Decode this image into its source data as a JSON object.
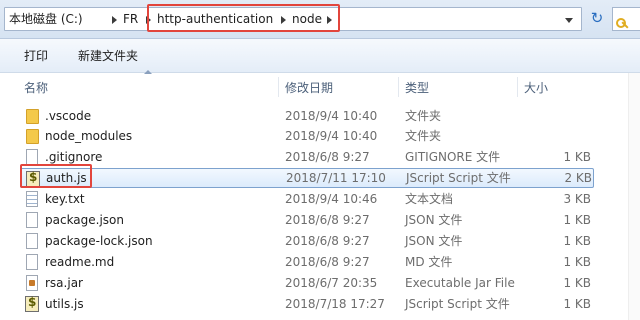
{
  "address": {
    "crumbs": [
      {
        "label": "本地磁盘 (C:)"
      },
      {
        "label": "FR"
      },
      {
        "label": "http-authentication"
      },
      {
        "label": "node"
      }
    ]
  },
  "toolbar": {
    "print_label": "打印",
    "new_folder_label": "新建文件夹"
  },
  "columns": {
    "name": "名称",
    "date": "修改日期",
    "type": "类型",
    "size": "大小"
  },
  "files": [
    {
      "name": ".vscode",
      "date": "2018/9/4 10:40",
      "type": "文件夹",
      "size": "",
      "icon": "folder-icon"
    },
    {
      "name": "node_modules",
      "date": "2018/9/4 10:40",
      "type": "文件夹",
      "size": "",
      "icon": "folder-icon"
    },
    {
      "name": ".gitignore",
      "date": "2018/6/8 9:27",
      "type": "GITIGNORE 文件",
      "size": "1 KB",
      "icon": "file-icon"
    },
    {
      "name": "auth.js",
      "date": "2018/7/11 17:10",
      "type": "JScript Script 文件",
      "size": "2 KB",
      "icon": "jscript-icon",
      "selected": true
    },
    {
      "name": "key.txt",
      "date": "2018/9/4 10:46",
      "type": "文本文档",
      "size": "3 KB",
      "icon": "text-file-icon"
    },
    {
      "name": "package.json",
      "date": "2018/6/8 9:27",
      "type": "JSON 文件",
      "size": "1 KB",
      "icon": "file-icon"
    },
    {
      "name": "package-lock.json",
      "date": "2018/6/8 9:27",
      "type": "JSON 文件",
      "size": "1 KB",
      "icon": "file-icon"
    },
    {
      "name": "readme.md",
      "date": "2018/6/8 9:27",
      "type": "MD 文件",
      "size": "1 KB",
      "icon": "file-icon"
    },
    {
      "name": "rsa.jar",
      "date": "2018/6/7 20:35",
      "type": "Executable Jar File",
      "size": "1 KB",
      "icon": "jar-icon"
    },
    {
      "name": "utils.js",
      "date": "2018/7/18 17:27",
      "type": "JScript Script 文件",
      "size": "1 KB",
      "icon": "jscript-icon"
    }
  ],
  "colors": {
    "highlight_border": "#e2453c",
    "selection_bg": "#dcebfc",
    "selection_border": "#7da2ce"
  }
}
